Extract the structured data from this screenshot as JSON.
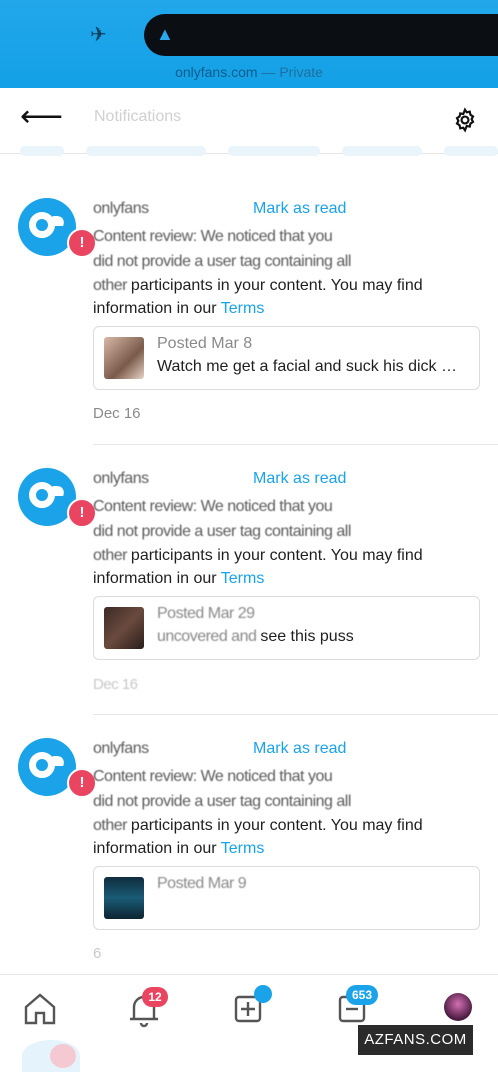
{
  "status_bar": {
    "url_text": "onlyfans.com",
    "url_suffix": " — Private"
  },
  "header": {
    "back_icon": "arrow-left-icon",
    "title": "Notifications",
    "settings_icon": "gear-icon"
  },
  "notifications": [
    {
      "head_prefix": "onlyfans",
      "mark_label": "Mark as read",
      "line2": "Content review: We noticed that you",
      "line3": "did not provide a user tag containing all",
      "line4_prefix": "other ",
      "line4_main": "participants in your content",
      "line4_suffix": ". You may find",
      "line5_prefix": "information in our ",
      "terms_label": "Terms",
      "post_date": "Posted Mar 8",
      "post_text": "Watch me get a facial and suck his dick …",
      "date": "Dec 16"
    },
    {
      "head_prefix": "onlyfans",
      "mark_label": "Mark as read",
      "line2": "Content review: We noticed that you",
      "line3": "did not provide a user tag containing all",
      "line4_prefix": "other ",
      "line4_main": "participants in your content",
      "line4_suffix": ". You may find",
      "line5_prefix": "information in our ",
      "terms_label": "Terms",
      "post_date": "Posted Mar 29",
      "post_text": "see this puss",
      "date": "Dec 16"
    },
    {
      "head_prefix": "onlyfans",
      "mark_label": "Mark as read",
      "line2": "Content review: We noticed that you",
      "line3": "did not provide a user tag containing all",
      "line4_prefix": "other ",
      "line4_main": "participants in your content",
      "line4_suffix": ". You may find",
      "line5_prefix": "information in our ",
      "terms_label": "Terms",
      "post_date": "Posted Mar 9",
      "post_text": "",
      "date": "6"
    }
  ],
  "bottom_nav": {
    "home_icon": "home-icon",
    "bell_icon": "bell-icon",
    "bell_badge": "12",
    "add_icon": "plus-square-icon",
    "messages_icon": "message-icon",
    "messages_badge": "653",
    "profile_icon": "avatar"
  },
  "watermark": "AZFANS.COM",
  "colors": {
    "accent": "#1aa3e8",
    "badge_red": "#e94560",
    "status_bar": "#1aa3e8"
  }
}
